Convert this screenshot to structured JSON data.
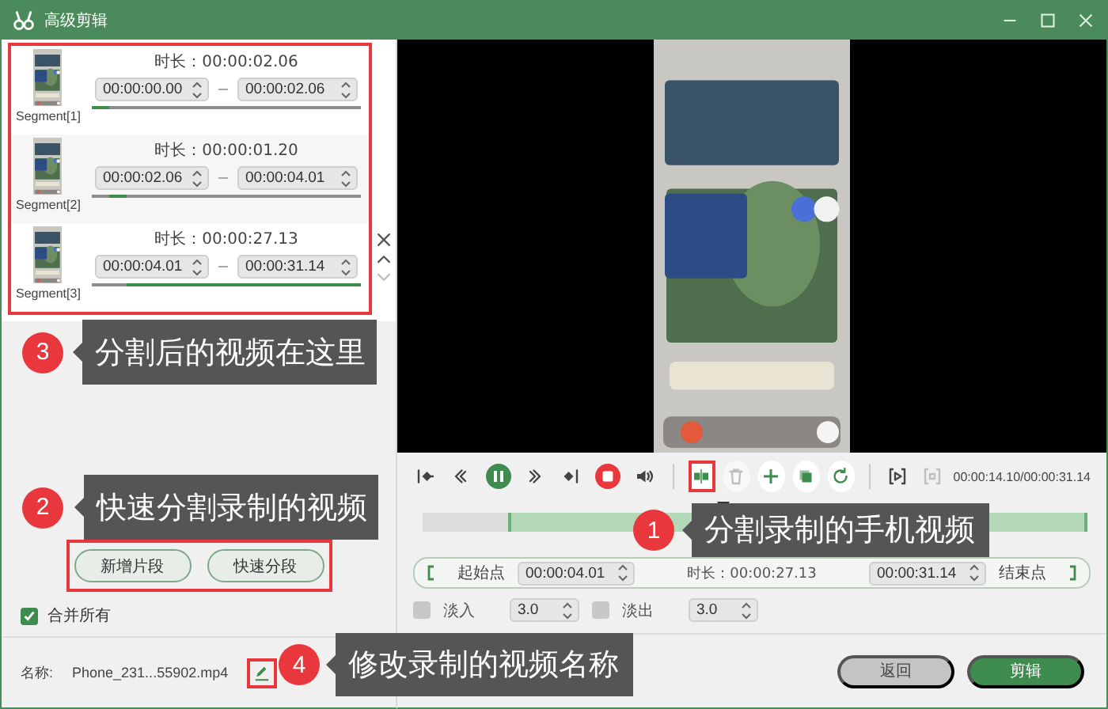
{
  "window": {
    "title": "高级剪辑"
  },
  "segments": [
    {
      "label": "Segment[1]",
      "duration_label": "时长：",
      "duration": "00:00:02.06",
      "start": "00:00:00.00",
      "end": "00:00:02.06"
    },
    {
      "label": "Segment[2]",
      "duration_label": "时长：",
      "duration": "00:00:01.20",
      "start": "00:00:02.06",
      "end": "00:00:04.01"
    },
    {
      "label": "Segment[3]",
      "duration_label": "时长：",
      "duration": "00:00:27.13",
      "start": "00:00:04.01",
      "end": "00:00:31.14"
    }
  ],
  "segment_list_highlighted": true,
  "list_controls": [
    {
      "kind": "close",
      "disabled": false
    },
    {
      "kind": "up",
      "disabled": false
    },
    {
      "kind": "down",
      "disabled": true
    }
  ],
  "segment_buttons": {
    "highlighted": true,
    "items": [
      "新增片段",
      "快速分段"
    ]
  },
  "merge_all": {
    "label": "合并所有",
    "checked": true
  },
  "file_name": {
    "label": "名称:",
    "value": "Phone_231...55902.mp4",
    "edit_highlighted": true
  },
  "player": {
    "controls": [
      {
        "kind": "skip-start",
        "disabled": false,
        "highlighted": false
      },
      {
        "kind": "step-back",
        "disabled": false,
        "highlighted": false
      },
      {
        "kind": "pause",
        "disabled": false,
        "highlighted": false
      },
      {
        "kind": "step-forward",
        "disabled": false,
        "highlighted": false
      },
      {
        "kind": "skip-end",
        "disabled": false,
        "highlighted": false
      },
      {
        "kind": "stop",
        "disabled": false,
        "highlighted": false
      },
      {
        "kind": "volume",
        "disabled": false,
        "highlighted": false
      },
      {
        "kind": "separator"
      },
      {
        "kind": "split",
        "disabled": false,
        "highlighted": true
      },
      {
        "kind": "delete",
        "disabled": true,
        "highlighted": false
      },
      {
        "kind": "add",
        "disabled": false,
        "highlighted": false
      },
      {
        "kind": "copy",
        "disabled": false,
        "highlighted": false
      },
      {
        "kind": "rotate",
        "disabled": false,
        "highlighted": false
      },
      {
        "kind": "separator"
      },
      {
        "kind": "play-range",
        "disabled": false,
        "highlighted": false
      },
      {
        "kind": "stop-range",
        "disabled": true,
        "highlighted": false
      }
    ],
    "time_readout": "00:00:14.10/00:00:31.14"
  },
  "trim": {
    "start_label": "起始点",
    "start": "00:00:04.01",
    "duration_label": "时长：",
    "duration": "00:00:27.13",
    "end": "00:00:31.14",
    "end_label": "结束点"
  },
  "fades": [
    {
      "label": "淡入",
      "checked": false,
      "value": "3.0"
    },
    {
      "label": "淡出",
      "checked": false,
      "value": "3.0"
    }
  ],
  "actions": [
    {
      "label": "返回",
      "kind": "secondary"
    },
    {
      "label": "剪辑",
      "kind": "primary"
    }
  ],
  "callouts": [
    {
      "number": "3",
      "text": "分割后的视频在这里"
    },
    {
      "number": "2",
      "text": "快速分割录制的视频"
    },
    {
      "number": "1",
      "text": "分割录制的手机视频"
    },
    {
      "number": "4",
      "text": "修改录制的视频名称"
    }
  ]
}
